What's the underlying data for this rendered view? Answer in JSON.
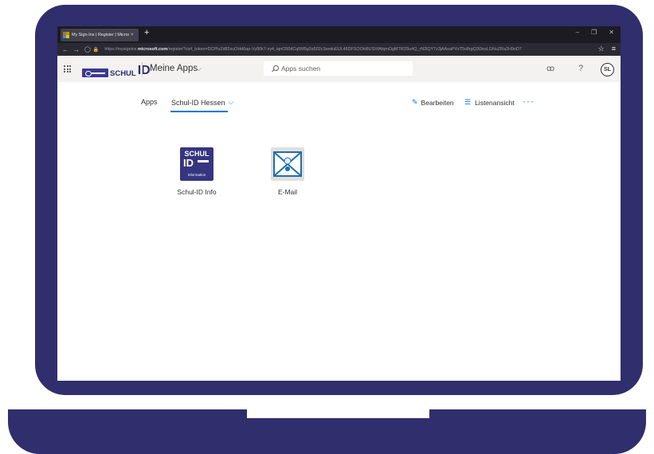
{
  "browser": {
    "tab_title": "My Sign-Ins | Register | Microso",
    "tab_close": "×",
    "new_tab": "+",
    "url_prefix": "https://mysignins.",
    "url_domain": "microsoft.com",
    "url_rest": "/register?csrf_token=DCPIsZd82xuOHd0ap-Vy80k7-zy4_iqnO50dCq5M5g2a502cSewluEUL46DFSOOH8USXfAfqmOgMTR3Su4Q_rN2lQY7z3jAAsaPVxT5v8rgQ3i3esLGNuZRa2H9oD7",
    "win_minimize": "–",
    "win_restore": "❐",
    "win_close": "✕",
    "nav_back": "←",
    "nav_forward": "→",
    "nav_shield": "◯",
    "nav_lock": "🔒",
    "bookmark_star": "☆",
    "menu_icon": "≡"
  },
  "header": {
    "logo_schul": "SCHUL",
    "logo_id": "ID",
    "title": "Meine Apps",
    "chevron": "⌵",
    "search_placeholder": "Apps suchen",
    "org_icon": "ꝏ",
    "help_icon": "?",
    "avatar_initials": "SL"
  },
  "tabs": {
    "apps_label": "Apps",
    "group_label": "Schul-ID Hessen",
    "group_chevron": "⌵",
    "edit_label": "Bearbeiten",
    "list_label": "Listenansicht",
    "more": "···"
  },
  "apps": [
    {
      "label": "Schul-ID Info",
      "icon_line1": "SCHUL",
      "icon_line2": "ID",
      "icon_line3": "Information"
    },
    {
      "label": "E-Mail"
    }
  ],
  "colors": {
    "laptop": "#302e6c",
    "accent": "#0078d4",
    "schul_brand": "#36357f"
  }
}
